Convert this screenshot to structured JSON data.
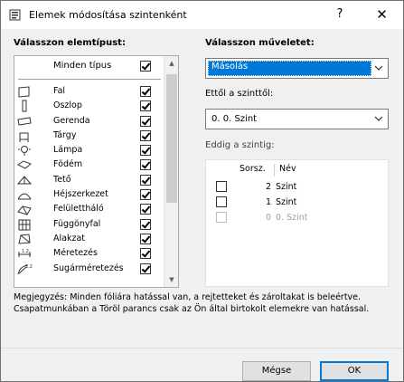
{
  "window": {
    "title": "Elemek módosítása szintenként",
    "help_label": "?",
    "close_label": "✕"
  },
  "left": {
    "heading": "Válasszon elemtípust:",
    "all_types": {
      "label": "Minden típus",
      "checked": true
    },
    "items": [
      {
        "label": "Fal",
        "icon": "wall-icon",
        "checked": true
      },
      {
        "label": "Oszlop",
        "icon": "column-icon",
        "checked": true
      },
      {
        "label": "Gerenda",
        "icon": "beam-icon",
        "checked": true
      },
      {
        "label": "Tárgy",
        "icon": "object-icon",
        "checked": true
      },
      {
        "label": "Lámpa",
        "icon": "lamp-icon",
        "checked": true
      },
      {
        "label": "Födém",
        "icon": "slab-icon",
        "checked": true
      },
      {
        "label": "Tető",
        "icon": "roof-icon",
        "checked": true
      },
      {
        "label": "Héjszerkezet",
        "icon": "shell-icon",
        "checked": true
      },
      {
        "label": "Felülettháló",
        "icon": "mesh-icon",
        "checked": true
      },
      {
        "label": "Függönyfal",
        "icon": "curtain-wall-icon",
        "checked": true
      },
      {
        "label": "Alakzat",
        "icon": "morph-icon",
        "checked": true
      },
      {
        "label": "Méretezés",
        "icon": "dimension-icon",
        "checked": true
      },
      {
        "label": "Sugárméretezés",
        "icon": "radial-dimension-icon",
        "checked": true
      }
    ]
  },
  "right": {
    "operation_heading": "Válasszon műveletet:",
    "operation_value": "Másolás",
    "from_heading": "Ettől a szinttől:",
    "from_value": "0. 0. Szint",
    "to_heading": "Eddig a szintig:",
    "table": {
      "col_number": "Sorsz.",
      "col_name": "Név",
      "rows": [
        {
          "number": "2",
          "name": "Szint",
          "checked": false,
          "enabled": true
        },
        {
          "number": "1",
          "name": "Szint",
          "checked": false,
          "enabled": true
        },
        {
          "number": "0",
          "name": "0. Szint",
          "checked": false,
          "enabled": false
        }
      ]
    }
  },
  "note": "Megjegyzés: Minden fóliára hatással van, a rejtetteket és zároltakat is beleértve. Csapatmunkában a Töröl parancs csak az Ön által birtokolt elemekre van hatással.",
  "buttons": {
    "cancel": "Mégse",
    "ok": "OK"
  },
  "colors": {
    "selection": "#0078d7",
    "dialog_bg": "#f0f0f0"
  }
}
